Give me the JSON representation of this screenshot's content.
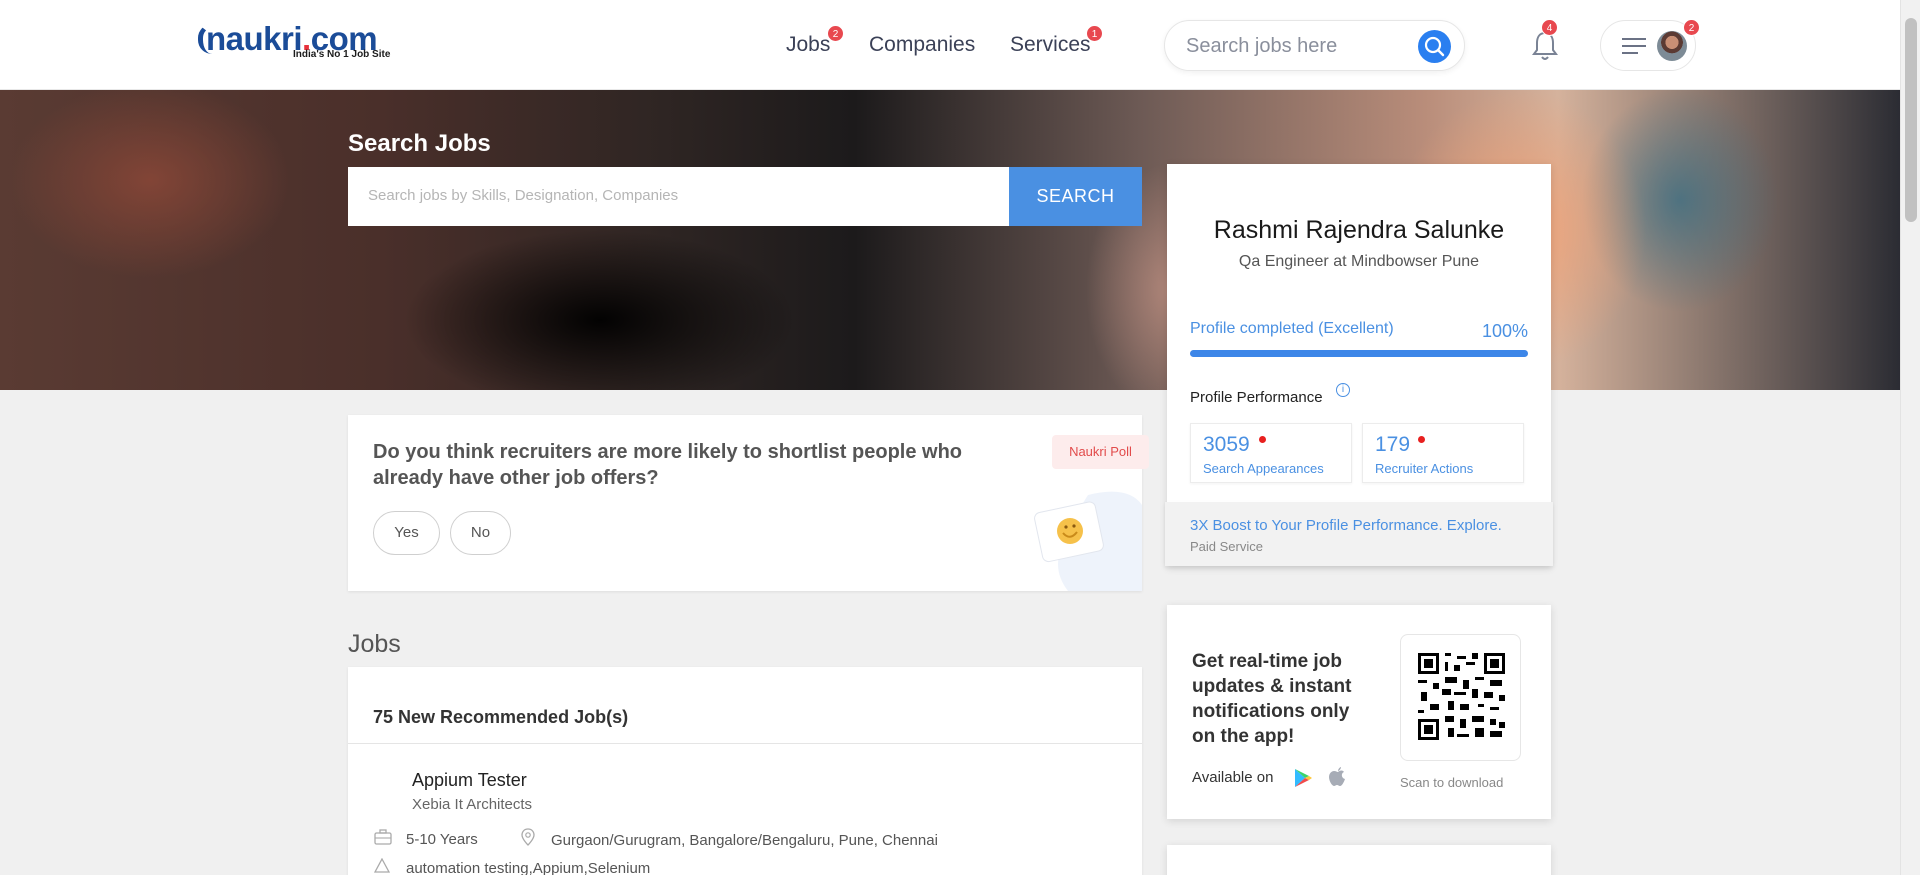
{
  "header": {
    "logo_text": "naukri",
    "logo_dot": ".",
    "logo_com": "com",
    "logo_tagline": "India's No 1 Job Site",
    "nav": [
      {
        "label": "Jobs",
        "badge": "2"
      },
      {
        "label": "Companies"
      },
      {
        "label": "Services",
        "badge": "1"
      }
    ],
    "search_placeholder": "Search jobs here",
    "notification_badge": "4",
    "menu_badge": "2"
  },
  "hero": {
    "title": "Search Jobs",
    "search_placeholder": "Search jobs by Skills, Designation, Companies",
    "search_button": "SEARCH"
  },
  "profile": {
    "name": "Rashmi Rajendra Salunke",
    "title": "Qa Engineer at Mindbowser Pune",
    "completion_label": "Profile completed (Excellent)",
    "completion_pct": "100%",
    "completion_value": 100,
    "performance_label": "Profile Performance",
    "stats": [
      {
        "value": "3059",
        "label": "Search Appearances"
      },
      {
        "value": "179",
        "label": "Recruiter Actions"
      }
    ],
    "boost_text": "3X Boost to Your Profile Performance. Explore.",
    "boost_sub": "Paid Service"
  },
  "poll": {
    "question": "Do you think recruiters are more likely to shortlist people who already have other job offers?",
    "tag": "Naukri Poll",
    "options": [
      "Yes",
      "No"
    ]
  },
  "app_promo": {
    "text": "Get real-time job updates & instant notifications only on the app!",
    "available_on": "Available on",
    "scan_caption": "Scan to download"
  },
  "jobs": {
    "heading": "Jobs",
    "count_label": "75 New Recommended Job(s)",
    "items": [
      {
        "title": "Appium Tester",
        "company": "Xebia It Architects",
        "experience": "5-10 Years",
        "location": "Gurgaon/Gurugram, Bangalore/Bengaluru, Pune, Chennai",
        "skills": "automation testing,Appium,Selenium"
      }
    ]
  },
  "colors": {
    "accent": "#4a90e2",
    "badge": "#e8484f",
    "brand": "#1b4c98"
  }
}
